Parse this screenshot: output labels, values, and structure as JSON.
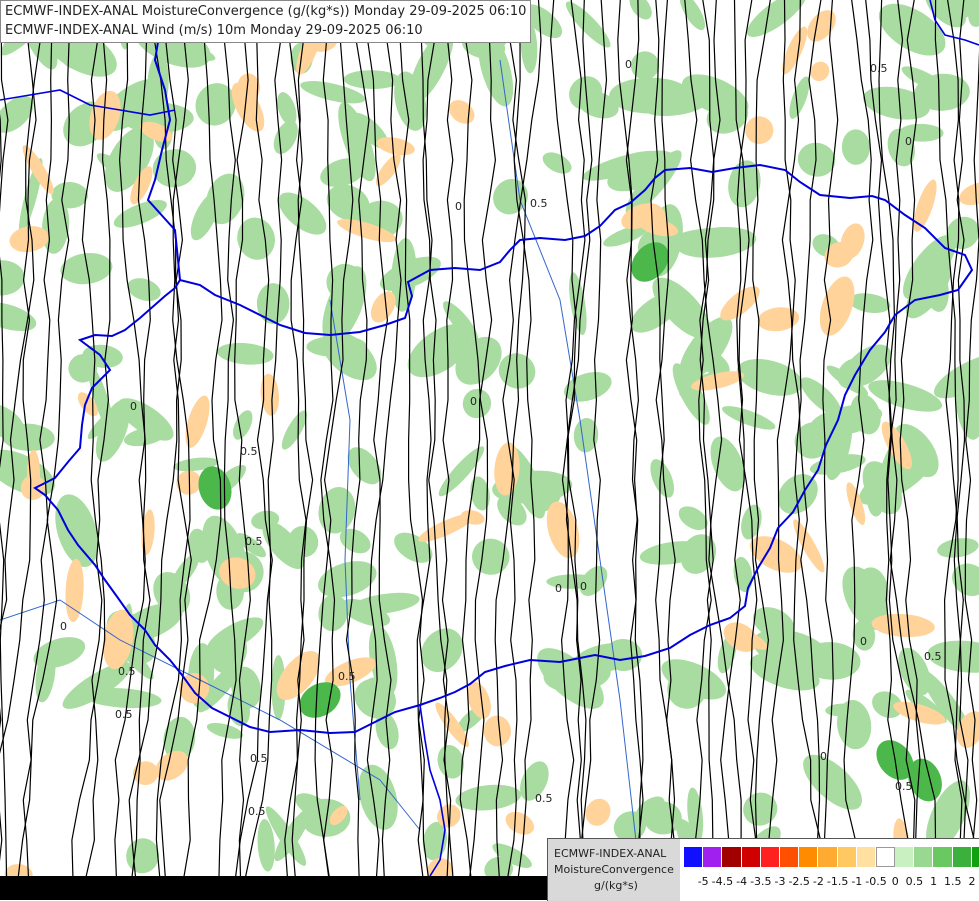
{
  "titles": {
    "line1": "ECMWF-INDEX-ANAL MoistureConvergence (g/(kg*s)) Monday 29-09-2025 06:10",
    "line2": "ECMWF-INDEX-ANAL Wind (m/s) 10m Monday 29-09-2025 06:10"
  },
  "legend": {
    "model": "ECMWF-INDEX-ANAL",
    "parameter": "MoistureConvergence",
    "unit": "g/(kg*s)",
    "colors": [
      "#1010ff",
      "#a020f0",
      "#a00000",
      "#d00000",
      "#ff2020",
      "#ff5000",
      "#ff8c00",
      "#ffaa30",
      "#ffc860",
      "#ffe0a0",
      "#ffffff",
      "#c8f0c0",
      "#98d890",
      "#6ac860",
      "#3cb03c",
      "#10a010"
    ],
    "tick_labels": [
      "-5",
      "-4.5",
      "-4",
      "-3.5",
      "-3",
      "-2.5",
      "-2",
      "-1.5",
      "-1",
      "-0.5",
      "0",
      "0.5",
      "1",
      "1.5",
      "2"
    ]
  },
  "contour_labels": [
    "0",
    "0.5"
  ],
  "colors": {
    "border": "#0000dd",
    "river": "#3366cc",
    "streamline": "#000000",
    "green": "#a8dca0",
    "green_dark": "#4cb84c",
    "orange": "#ffd39a"
  }
}
